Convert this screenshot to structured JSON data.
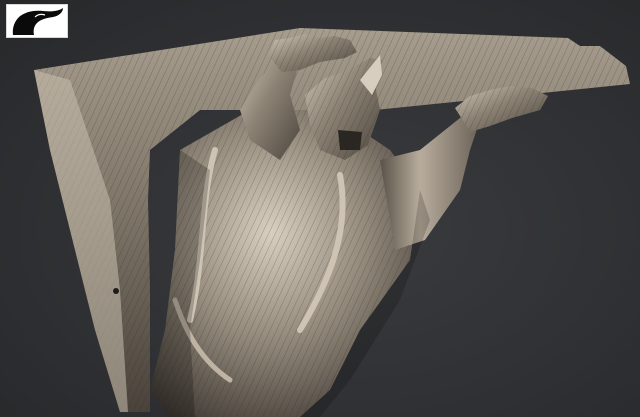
{
  "viewport": {
    "subject": "sculpted-rhino-figure-render",
    "background_color": "#2f3033",
    "material_color": "#9a8f80",
    "shadow_color": "#1a1a1c",
    "highlight_color": "#e6ddcf"
  },
  "logo": {
    "icon": "bird-silhouette-icon",
    "background_color": "#ffffff",
    "ink_color": "#0a0a0a"
  }
}
